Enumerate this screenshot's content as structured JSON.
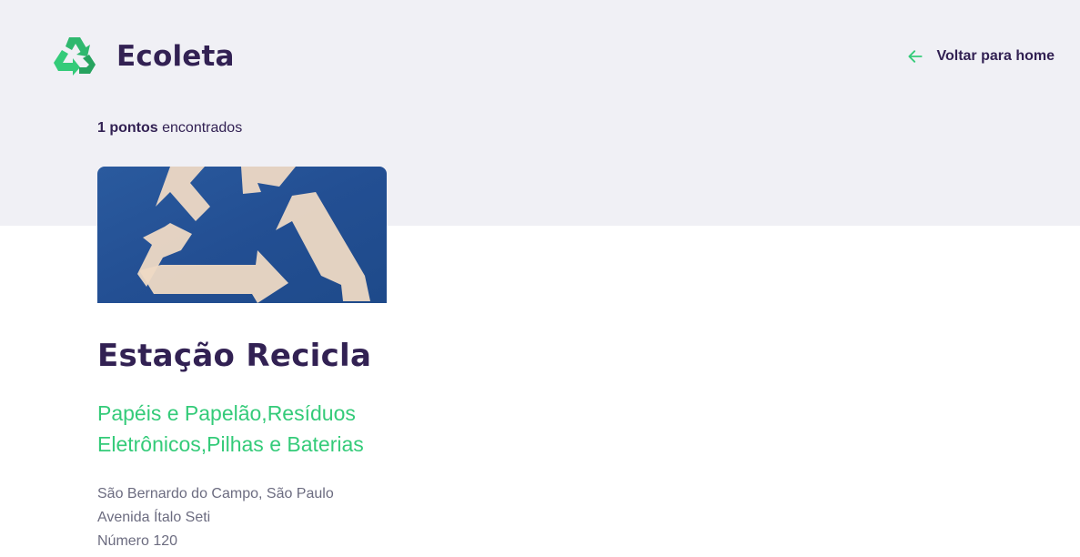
{
  "app": {
    "name": "Ecoleta",
    "logo_icon": "recycle-icon"
  },
  "header": {
    "back_label": "Voltar para home",
    "back_icon": "arrow-left-icon"
  },
  "results": {
    "count_strong": "1 pontos",
    "count_suffix": "encontrados"
  },
  "points": [
    {
      "name": "Estação Recicla",
      "items": "Papéis e Papelão,Resíduos Eletrônicos,Pilhas e Baterias",
      "city_state": "São Bernardo do Campo, São Paulo",
      "street": "Avenida Ítalo Seti",
      "number": "Número 120",
      "image_icon": "recycle-symbol-photo"
    }
  ],
  "colors": {
    "primary": "#34cb79",
    "title": "#322153",
    "text": "#6c6c80",
    "background": "#f0f0f5"
  }
}
